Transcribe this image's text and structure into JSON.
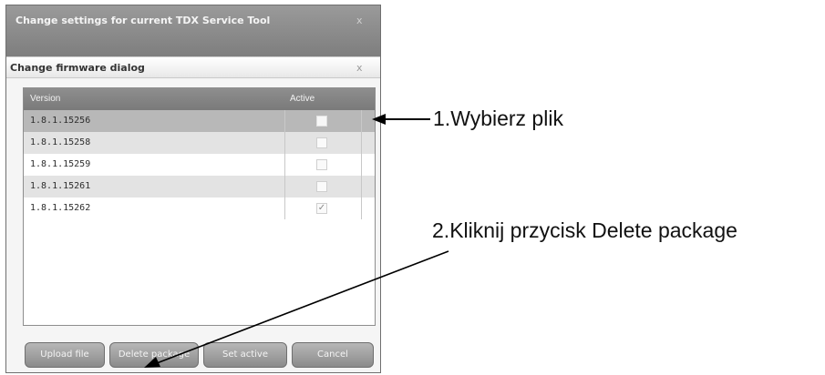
{
  "outer_window": {
    "title": "Change settings for current TDX Service Tool",
    "close_glyph": "x"
  },
  "dialog": {
    "title": "Change firmware dialog",
    "close_glyph": "x",
    "grid": {
      "columns": [
        "Version",
        "Active"
      ],
      "rows": [
        {
          "version": "1.8.1.15256",
          "active": false,
          "selected": true
        },
        {
          "version": "1.8.1.15258",
          "active": false
        },
        {
          "version": "1.8.1.15259",
          "active": false
        },
        {
          "version": "1.8.1.15261",
          "active": false
        },
        {
          "version": "1.8.1.15262",
          "active": true
        }
      ]
    },
    "buttons": {
      "upload": "Upload file",
      "delete": "Delete package",
      "set_active": "Set active",
      "cancel": "Cancel"
    }
  },
  "annotations": {
    "step1_num": "1.",
    "step1_text": "Wybierz plik",
    "step2_num": "2.",
    "step2_text": "Kliknij przycisk Delete package"
  },
  "colors": {
    "header": "#858585",
    "selected_row": "#b8b8b8",
    "alt_row": "#e3e3e3",
    "button": "#9c9c9c"
  }
}
